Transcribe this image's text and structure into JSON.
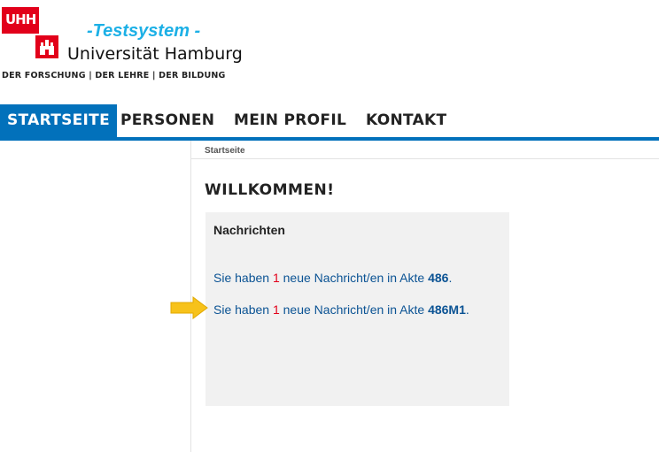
{
  "header": {
    "logo_text": "UHH",
    "system_label": "-Testsystem -",
    "university_name": "Universität Hamburg",
    "tagline": "DER FORSCHUNG | DER LEHRE | DER BILDUNG"
  },
  "nav": {
    "items": [
      {
        "label": "STARTSEITE",
        "active": true
      },
      {
        "label": "PERSONEN",
        "active": false
      },
      {
        "label": "MEIN PROFIL",
        "active": false
      },
      {
        "label": "KONTAKT",
        "active": false
      }
    ]
  },
  "breadcrumb": "Startseite",
  "page_title": "WILLKOMMEN!",
  "messages": {
    "title": "Nachrichten",
    "items": [
      {
        "prefix": "Sie haben ",
        "count": "1",
        "middle": " neue Nachricht/en in Akte ",
        "akte": "486",
        "suffix": "."
      },
      {
        "prefix": "Sie haben ",
        "count": "1",
        "middle": " neue Nachricht/en in Akte ",
        "akte": "486M1",
        "suffix": "."
      }
    ]
  },
  "colors": {
    "brand_red": "#e2001a",
    "nav_blue": "#0271bb",
    "link_blue": "#0b5394",
    "testsystem_cyan": "#1cb0e6",
    "arrow_yellow": "#f7c21a"
  },
  "icons": {
    "seal": "hamburg-castle-seal-icon",
    "arrow": "right-arrow-pointer-icon"
  }
}
